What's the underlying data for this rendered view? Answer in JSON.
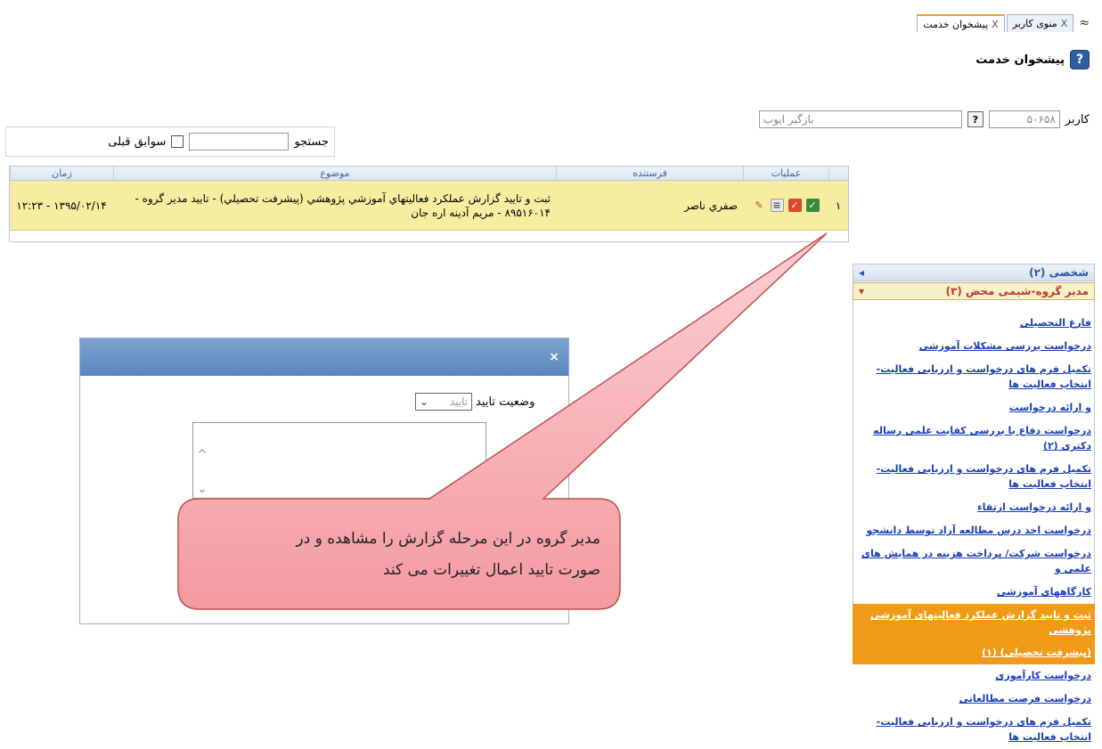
{
  "tabs": {
    "nav_glyph": "≈",
    "items": [
      {
        "label": "منوی کاربر",
        "close": "X"
      },
      {
        "label": "پیشخوان خدمت",
        "close": "X"
      }
    ]
  },
  "page": {
    "title": "پیشخوان خدمت",
    "help_glyph": "?"
  },
  "user_row": {
    "label": "کاربر",
    "code": "۵۰۶۵۸",
    "lookup_glyph": "?",
    "name": "بازگیر ایوب"
  },
  "search": {
    "label": "جستجو",
    "history_label": "سوابق قبلی"
  },
  "grid": {
    "headers": {
      "operations": "عملیات",
      "sender": "فرستنده",
      "subject": "موضوع",
      "time": "زمان"
    },
    "rows": [
      {
        "row_num": "۱",
        "sender": "صفري ناصر",
        "subject_line1": "ثبت و تاييد گزارش عملکرد فعاليتهاي آموزشي پژوهشي (پيشرفت تحصيلي) - تاييد مدير گروه -",
        "subject_line2": "۸۹۵۱۶۰۱۴ - مريم آدينه اره جان",
        "time": "۱۳۹۵/۰۲/۱۴ - ۱۲:۲۳"
      }
    ]
  },
  "menu": {
    "group1": {
      "label": "شخصی (۲)",
      "arrow": "◂"
    },
    "group2": {
      "label": "مدیر گروه-شیمی محض (۳)",
      "arrow": "▾"
    },
    "items": [
      "فارغ التحصیلی",
      "درخواست بررسی مشکلات آموزشی",
      "تکمیل فرم های درخواست و ارزیابی فعالیت- انتخاب فعالیت ها",
      "و ارائه درخواست",
      "درخواست دفاع یا بررسی کفایت علمی رساله دکتری (۲)",
      "تکمیل فرم های درخواست و ارزیابی فعالیت- انتخاب فعالیت ها",
      "و ارائه درخواست ارتقاء",
      "درخواست اخذ درس مطالعه آزاد توسط دانشجو",
      "درخواست شرکت/ پرداخت هزینه در همایش های علمی و",
      "کارگاههای آموزشی",
      "ثبت و تایید گزارش عملکرد فعالیتهای آموزشی پژوهشی",
      "(پیشرفت تحصیلی) (۱)",
      "درخواست کارآموزی",
      "درخواست فرصت مطالعاتی",
      "تکمیل فرم های درخواست و ارزیابی فعالیت- انتخاب فعالیت ها"
    ]
  },
  "dialog": {
    "close_glyph": "×",
    "status_label": "وضعیت تایید",
    "status_value": "تایید",
    "select_arrow": "⌄",
    "scroll_up": "^",
    "scroll_down": "⌄"
  },
  "callout": {
    "line1": "مدیر گروه در این مرحله گزارش را مشاهده و در",
    "line2": "صورت تایید اعمال تغییرات می کند"
  },
  "colors": {
    "accent": "#f09a1a",
    "row_highlight": "#f7eda0",
    "link": "#1a3fb8",
    "callout_fill": "#f8b6bb"
  }
}
